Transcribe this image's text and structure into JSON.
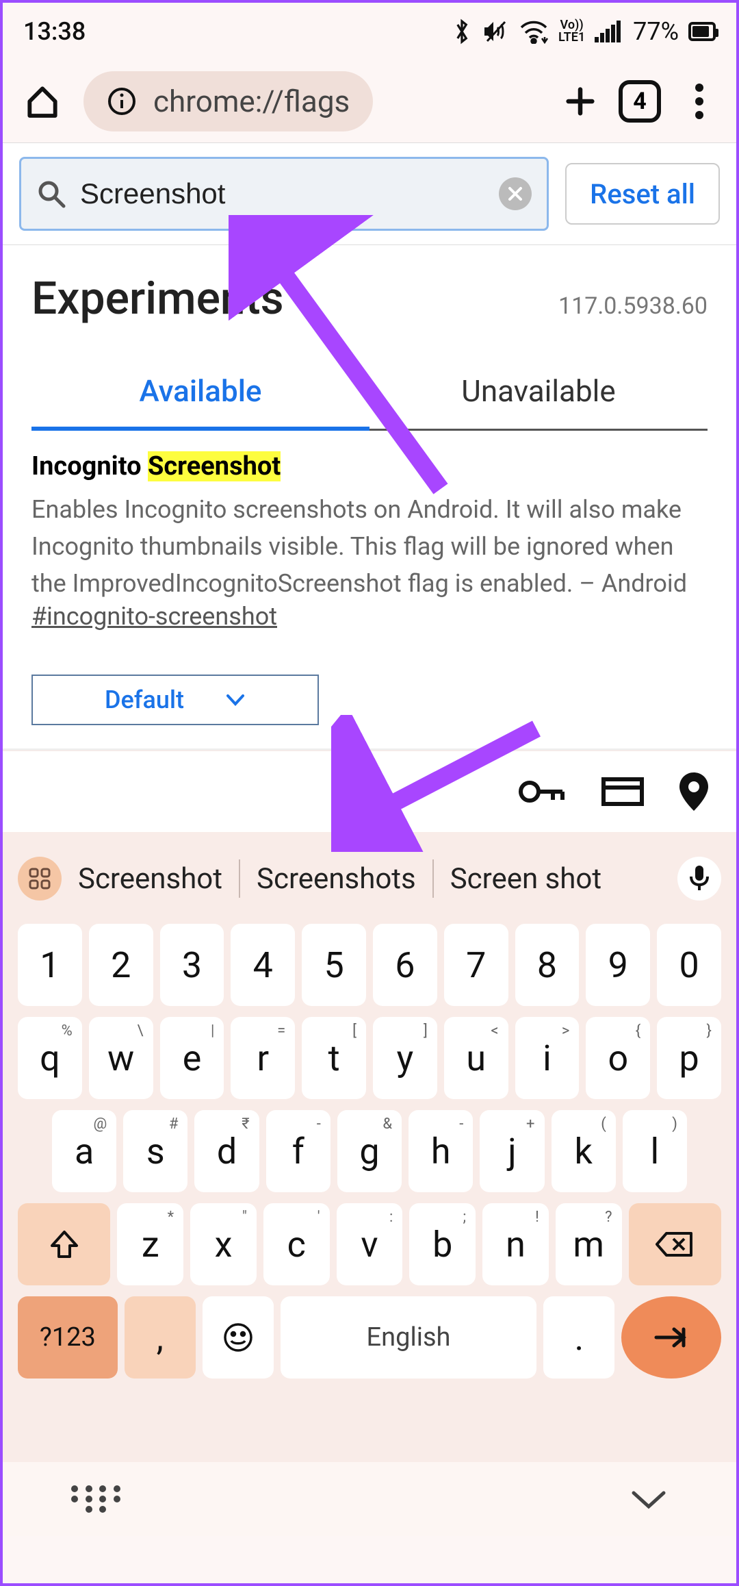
{
  "status": {
    "time": "13:38",
    "battery_pct": "77%",
    "battery_fill": 0.77,
    "network_label": "Vo))\nLTE1"
  },
  "toolbar": {
    "url": "chrome://flags",
    "tab_count": "4"
  },
  "search": {
    "value": "Screenshot",
    "reset_label": "Reset all"
  },
  "experiments": {
    "title": "Experiments",
    "version": "117.0.5938.60",
    "tabs": {
      "available": "Available",
      "unavailable": "Unavailable"
    }
  },
  "flag": {
    "title_prefix": "Incognito ",
    "title_highlight": "Screenshot",
    "description": "Enables Incognito screenshots on Android. It will also make Incognito thumbnails visible. This flag will be ignored when the ImprovedIncognitoScreenshot flag is enabled. – Android",
    "anchor": "#incognito-screenshot",
    "select_value": "Default"
  },
  "keyboard": {
    "suggestions": [
      "Screenshot",
      "Screenshots",
      "Screen shot"
    ],
    "row1": [
      "1",
      "2",
      "3",
      "4",
      "5",
      "6",
      "7",
      "8",
      "9",
      "0"
    ],
    "row2": [
      {
        "k": "q",
        "h": "%"
      },
      {
        "k": "w",
        "h": "\\"
      },
      {
        "k": "e",
        "h": "|"
      },
      {
        "k": "r",
        "h": "="
      },
      {
        "k": "t",
        "h": "["
      },
      {
        "k": "y",
        "h": "]"
      },
      {
        "k": "u",
        "h": "<"
      },
      {
        "k": "i",
        "h": ">"
      },
      {
        "k": "o",
        "h": "{"
      },
      {
        "k": "p",
        "h": "}"
      }
    ],
    "row3": [
      {
        "k": "a",
        "h": "@"
      },
      {
        "k": "s",
        "h": "#"
      },
      {
        "k": "d",
        "h": "₹"
      },
      {
        "k": "f",
        "h": "-"
      },
      {
        "k": "g",
        "h": "&"
      },
      {
        "k": "h",
        "h": "-"
      },
      {
        "k": "j",
        "h": "+"
      },
      {
        "k": "k",
        "h": "("
      },
      {
        "k": "l",
        "h": ")"
      }
    ],
    "row4": [
      {
        "k": "z",
        "h": "*"
      },
      {
        "k": "x",
        "h": "\""
      },
      {
        "k": "c",
        "h": "'"
      },
      {
        "k": "v",
        "h": ":"
      },
      {
        "k": "b",
        "h": ";"
      },
      {
        "k": "n",
        "h": "!"
      },
      {
        "k": "m",
        "h": "?"
      }
    ],
    "symbols_label": "?123",
    "space_label": "English",
    "comma": ",",
    "period": "."
  },
  "annotations": {
    "arrow_color": "#a846ff"
  }
}
